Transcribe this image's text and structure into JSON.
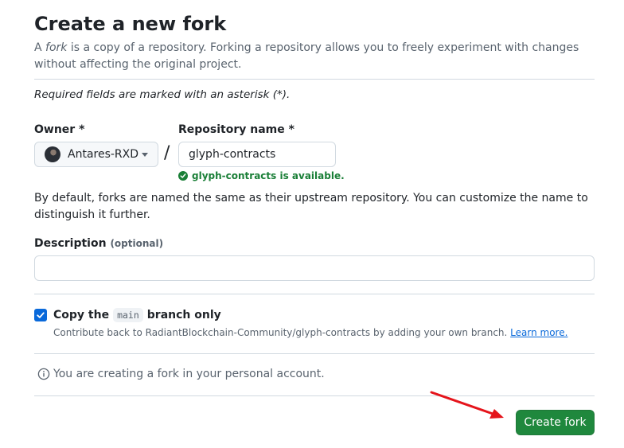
{
  "header": {
    "title": "Create a new fork",
    "intro_prefix": "A ",
    "intro_fork_word": "fork",
    "intro_suffix": " is a copy of a repository. Forking a repository allows you to freely experiment with changes without affecting the original project."
  },
  "form": {
    "required_note": "Required fields are marked with an asterisk (*).",
    "owner": {
      "label": "Owner *",
      "selected": "Antares-RXD"
    },
    "separator": "/",
    "repository_name": {
      "label": "Repository name *",
      "value": "glyph-contracts",
      "availability": "glyph-contracts is available."
    },
    "naming_help": "By default, forks are named the same as their upstream repository. You can customize the name to distinguish it further.",
    "description": {
      "label": "Description",
      "optional_tag": "(optional)",
      "value": "",
      "placeholder": ""
    },
    "copy_branch": {
      "checked": true,
      "label_prefix": "Copy the",
      "branch": "main",
      "label_suffix": "branch only",
      "sub_text": "Contribute back to RadiantBlockchain-Community/glyph-contracts by adding your own branch.",
      "learn_more": "Learn more."
    },
    "info_text": "You are creating a fork in your personal account.",
    "submit_label": "Create fork"
  },
  "colors": {
    "accent_blue": "#0969da",
    "success_green": "#1a7f37",
    "button_green": "#1f883d",
    "annotation_red": "#e5141b"
  },
  "icons": {
    "owner_caret": "chevron-down-icon",
    "availability": "check-circle-icon",
    "checkbox": "checkmark-icon",
    "info": "info-icon",
    "annotation": "red-arrow-icon"
  }
}
